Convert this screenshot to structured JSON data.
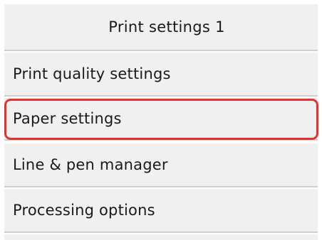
{
  "header": {
    "title": "Print settings 1"
  },
  "menu": {
    "items": [
      {
        "label": "Print quality settings"
      },
      {
        "label": "Paper settings",
        "selected": true
      },
      {
        "label": "Line & pen manager"
      },
      {
        "label": "Processing options"
      }
    ]
  },
  "colors": {
    "item_background": "#f0f0f0",
    "divider": "#cfcfcf",
    "selection_outline": "#e0342c",
    "text": "#1a1a1a"
  }
}
